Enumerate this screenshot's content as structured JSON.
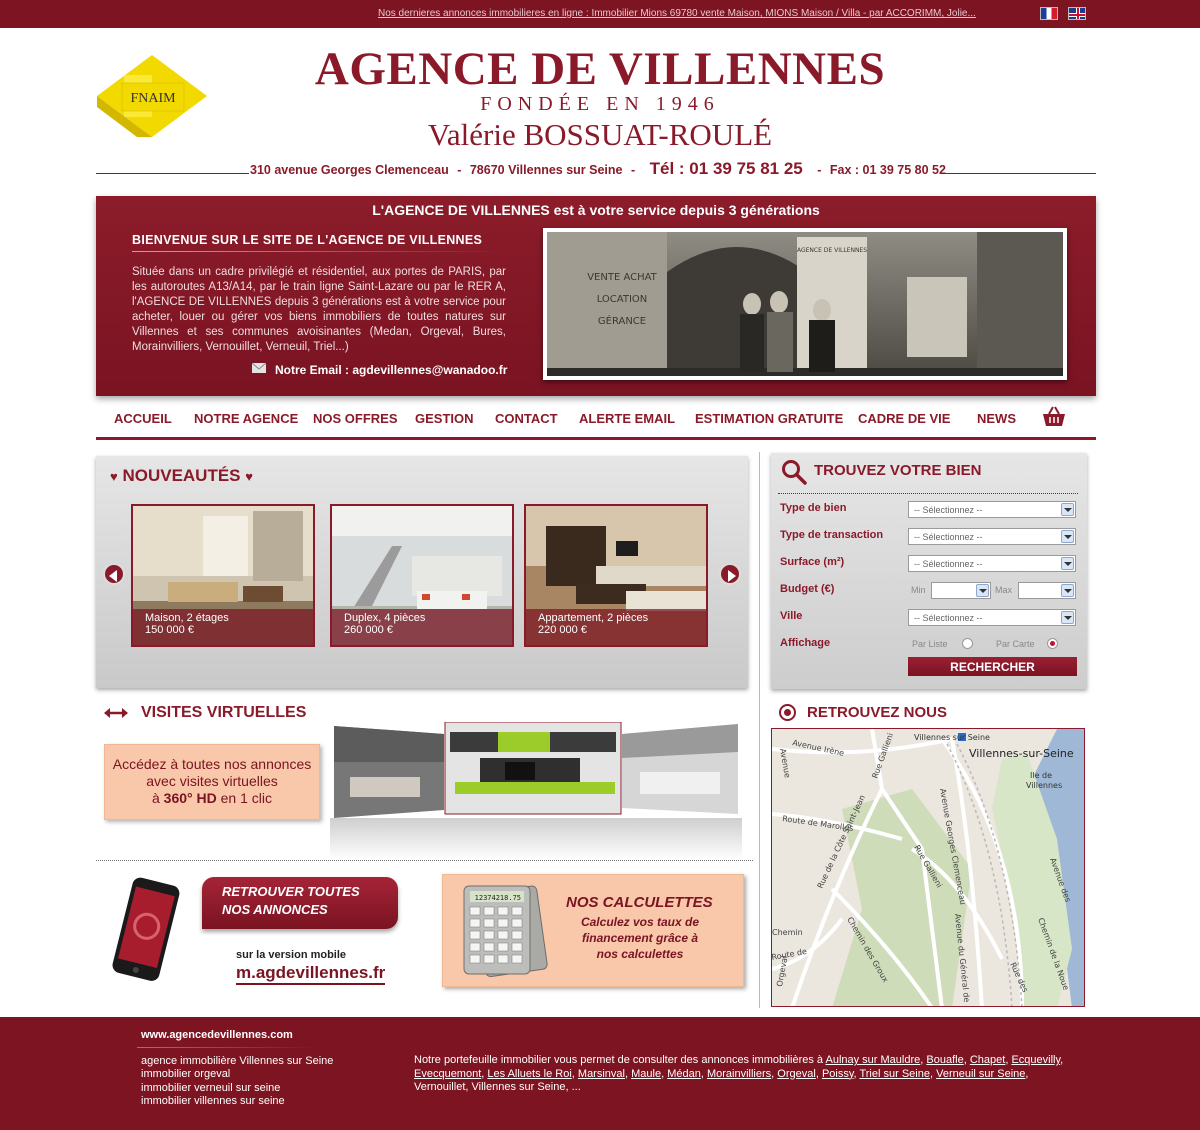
{
  "topbar": {
    "ticker": "Nos dernieres annonces immobilieres en ligne :  Immobilier Mions 69780 vente Maison, MIONS Maison / Villa - par ACCORIMM,  Jolie...",
    "lang_fr": "Français",
    "lang_en": "English"
  },
  "header": {
    "logo_text": "FNAIM",
    "title": "AGENCE DE VILLENNES",
    "subtitle": "FONDÉE EN 1946",
    "manager": "Valérie BOSSUAT-ROULÉ",
    "address": "310 avenue Georges Clemenceau",
    "city": "78670 Villennes sur Seine",
    "phone": "Tél : 01 39 75 81 25",
    "fax": "Fax : 01 39 75 80 52",
    "sep": "-"
  },
  "welcome": {
    "heading": "L'AGENCE DE VILLENNES est à votre service depuis 3 générations",
    "title": "BIENVENUE SUR LE SITE DE L'AGENCE DE VILLENNES",
    "text": "Située dans un cadre privilégié et résidentiel, aux portes de PARIS, par les autoroutes A13/A14, par le train ligne Saint-Lazare ou par le RER A, l'AGENCE DE VILLENNES depuis 3 générations est à votre service pour acheter, louer ou gérer vos biens immobiliers de toutes natures sur Villennes et ses communes avoisinantes (Medan, Orgeval, Bures, Morainvilliers, Vernouillet, Verneuil, Triel...)",
    "email_label": "Notre Email : agdevillennes@wanadoo.fr",
    "photo_sign_1": "VENTE ACHAT",
    "photo_sign_2": "LOCATION",
    "photo_sign_3": "GÉRANCE",
    "photo_sign_4": "AGENCE DE VILLENNES"
  },
  "nav": {
    "items": [
      "ACCUEIL",
      "NOTRE AGENCE",
      "NOS OFFRES",
      "GESTION",
      "CONTACT",
      "ALERTE EMAIL",
      "ESTIMATION GRATUITE",
      "CADRE DE VIE",
      "NEWS"
    ]
  },
  "news": {
    "title": "NOUVEAUTÉS",
    "cards": [
      {
        "type": "Maison, 2 étages",
        "price": "150 000 €"
      },
      {
        "type": "Duplex, 4 pièces",
        "price": "260 000 €"
      },
      {
        "type": "Appartement, 2 pièces",
        "price": "220 000 €"
      }
    ]
  },
  "search": {
    "title": "TROUVEZ VOTRE BIEN",
    "labels": {
      "type_bien": "Type de bien",
      "type_transaction": "Type de transaction",
      "surface": "Surface (m²)",
      "budget": "Budget (€)",
      "ville": "Ville",
      "affichage": "Affichage"
    },
    "placeholder": "-- Sélectionnez --",
    "min": "Min",
    "max": "Max",
    "par_liste": "Par Liste",
    "par_carte": "Par Carte",
    "button": "RECHERCHER"
  },
  "visits": {
    "title": "VISITES VIRTUELLES",
    "line1": "Accédez à toutes nos annonces",
    "line2": "avec visites virtuelles",
    "line3_pre": "à",
    "line3_bold": "360° HD",
    "line3_post": "en 1 clic"
  },
  "mobile": {
    "banner_1": "RETROUVER TOUTES",
    "banner_2": "NOS ANNONCES",
    "sub": "sur la version mobile",
    "url": "m.agdevillennes.fr"
  },
  "calc": {
    "title": "NOS CALCULETTES",
    "line1": "Calculez vos taux de",
    "line2": "financement grâce à",
    "line3": "nos calculettes",
    "display": "12374218.75"
  },
  "map": {
    "title": "RETROUVEZ NOUS",
    "labels": {
      "station": "Villennes sur Seine",
      "town": "Villennes-sur-Seine",
      "island_1": "Ile de",
      "island_2": "Villennes",
      "av_irene": "Avenue Irène",
      "rue_gallieni_1": "Rue Gallieni",
      "route_marolles": "Route de Marolles",
      "av_clemenceau": "Avenue Georges Clemenceau",
      "rue_gallieni_2": "Rue Gallieni",
      "cote_st_jean": "Rue de la Côte Saint-Jean",
      "av_general": "Avenue du Général de",
      "ch_groux": "Chemin des Groux",
      "rue_des": "Rue des",
      "ch_noue": "Chemin de la Noue",
      "av_des": "Avenue des",
      "orgeval": "Orgeval",
      "chemin": "Chemin",
      "route_de": "Route de",
      "avenue_left": "Avenue"
    }
  },
  "footer": {
    "site": "www.agencedevillennes.com",
    "links": [
      "agence immobilière Villennes sur Seine",
      "immobilier orgeval",
      "immobilier verneuil sur seine",
      "immobilier villennes sur seine"
    ],
    "portfolio_intro": "Notre portefeuille immobilier vous permet de consulter des annonces immobilières à",
    "towns": [
      "Aulnay sur Mauldre",
      "Bouafle",
      "Chapet",
      "Ecquevilly",
      "Evecquemont",
      "Les Alluets le Roi",
      "Marsinval",
      "Maule",
      "Médan",
      "Morainvilliers",
      "Orgeval",
      "Poissy",
      "Triel sur Seine",
      "Verneuil sur Seine",
      "Vernouillet",
      "Villennes sur Seine",
      "..."
    ]
  }
}
